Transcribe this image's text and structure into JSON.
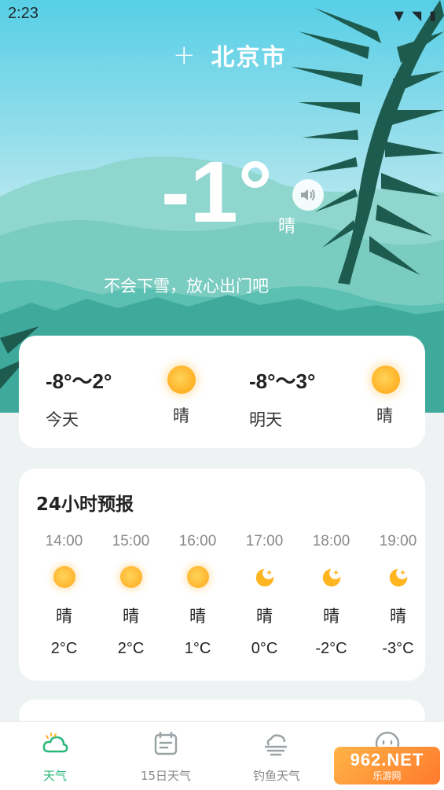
{
  "status_bar": {
    "time": "2:23"
  },
  "header": {
    "add_symbol": "+",
    "city": "北京市"
  },
  "current": {
    "temperature": "-1°",
    "condition": "晴",
    "tip": "不会下雪，放心出门吧"
  },
  "daily": [
    {
      "range": "-8°～2°",
      "day": "今天",
      "condition": "晴",
      "icon": "sun-icon"
    },
    {
      "range": "-8°～3°",
      "day": "明天",
      "condition": "晴",
      "icon": "sun-icon"
    }
  ],
  "hourly": {
    "title": "24小时预报",
    "items": [
      {
        "time": "14:00",
        "icon": "sun-icon",
        "condition": "晴",
        "temp": "2°C"
      },
      {
        "time": "15:00",
        "icon": "sun-icon",
        "condition": "晴",
        "temp": "2°C"
      },
      {
        "time": "16:00",
        "icon": "sun-icon",
        "condition": "晴",
        "temp": "1°C"
      },
      {
        "time": "17:00",
        "icon": "moon-icon",
        "condition": "晴",
        "temp": "0°C"
      },
      {
        "time": "18:00",
        "icon": "moon-icon",
        "condition": "晴",
        "temp": "-2°C"
      },
      {
        "time": "19:00",
        "icon": "moon-icon",
        "condition": "晴",
        "temp": "-3°C"
      }
    ]
  },
  "tabs": [
    {
      "label": "天气",
      "icon": "cloud-sun-icon",
      "active": true
    },
    {
      "label": "15日天气",
      "icon": "calendar-icon",
      "active": false
    },
    {
      "label": "钓鱼天气",
      "icon": "wind-cloud-icon",
      "active": false
    },
    {
      "label": "",
      "icon": "face-icon",
      "active": false
    }
  ],
  "watermark": {
    "main": "962.NET",
    "sub": "乐游网"
  },
  "colors": {
    "accent": "#2ab87a",
    "sun": "#ffb024",
    "palm": "#1e5b4f"
  }
}
